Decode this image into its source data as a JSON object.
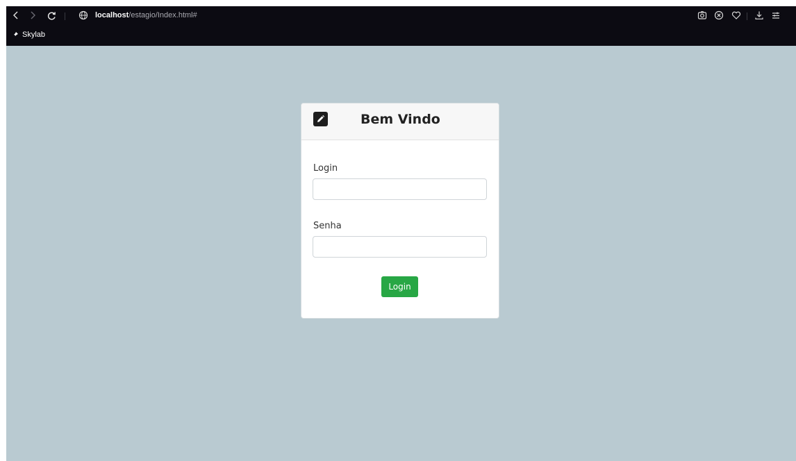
{
  "browser": {
    "url_host": "localhost",
    "url_path": "/estagio/Index.html#",
    "bookmark_label": "Skylab",
    "icons": {
      "back": "back-arrow-icon",
      "forward": "forward-arrow-icon",
      "reload": "reload-icon",
      "site": "globe-icon",
      "screenshot": "camera-icon",
      "shield": "shield-x-icon",
      "favorite": "heart-icon",
      "download": "download-icon",
      "menu": "sliders-menu-icon",
      "bookmark": "pin-icon"
    }
  },
  "card": {
    "title": "Bem Vindo",
    "header_icon": "pencil-edit-icon",
    "login_label": "Login",
    "login_value": "",
    "password_label": "Senha",
    "password_value": "",
    "submit_label": "Login"
  },
  "colors": {
    "page_background": "#b9cad1",
    "browser_chrome": "#0c0b12",
    "submit_button": "#28a745"
  }
}
